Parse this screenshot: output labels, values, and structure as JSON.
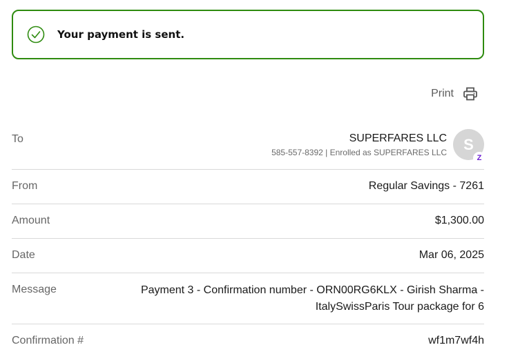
{
  "banner": {
    "message": "Your payment is sent.",
    "icon": "check-circle-icon",
    "color": "#2e8b0f"
  },
  "print": {
    "label": "Print",
    "icon": "printer-icon"
  },
  "details": {
    "to": {
      "label": "To",
      "name": "SUPERFARES LLC",
      "sub": "585-557-8392 | Enrolled as SUPERFARES LLC",
      "avatar_initial": "S",
      "badge": "Z"
    },
    "from": {
      "label": "From",
      "value": "Regular Savings - 7261"
    },
    "amount": {
      "label": "Amount",
      "value": "$1,300.00"
    },
    "date": {
      "label": "Date",
      "value": "Mar 06, 2025"
    },
    "message": {
      "label": "Message",
      "value": "Payment 3 - Confirmation number - ORN00RG6KLX - Girish Sharma - ItalySwissParis Tour package for 6"
    },
    "confirmation": {
      "label": "Confirmation #",
      "value": "wf1m7wf4h"
    }
  }
}
